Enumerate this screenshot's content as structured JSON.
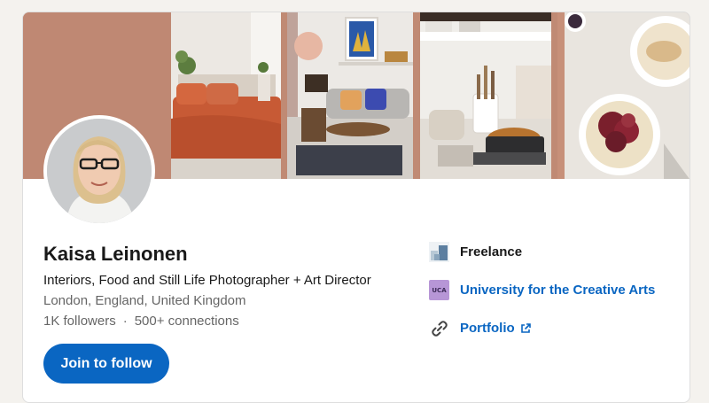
{
  "profile": {
    "name": "Kaisa Leinonen",
    "headline": "Interiors, Food and Still Life Photographer + Art Director",
    "location": "London, England, United Kingdom",
    "followers": "1K followers",
    "separator": "·",
    "connections": "500+ connections",
    "follow_button": "Join to follow"
  },
  "sidebar": {
    "company": "Freelance",
    "education": "University for the Creative Arts",
    "education_logo_text": "UCA",
    "portfolio": "Portfolio"
  },
  "colors": {
    "accent": "#0a66c2",
    "banner": "#c08a74"
  },
  "icons": {
    "company": "company-logo-icon",
    "school": "school-logo-icon",
    "link": "link-icon",
    "external": "external-link-icon"
  }
}
